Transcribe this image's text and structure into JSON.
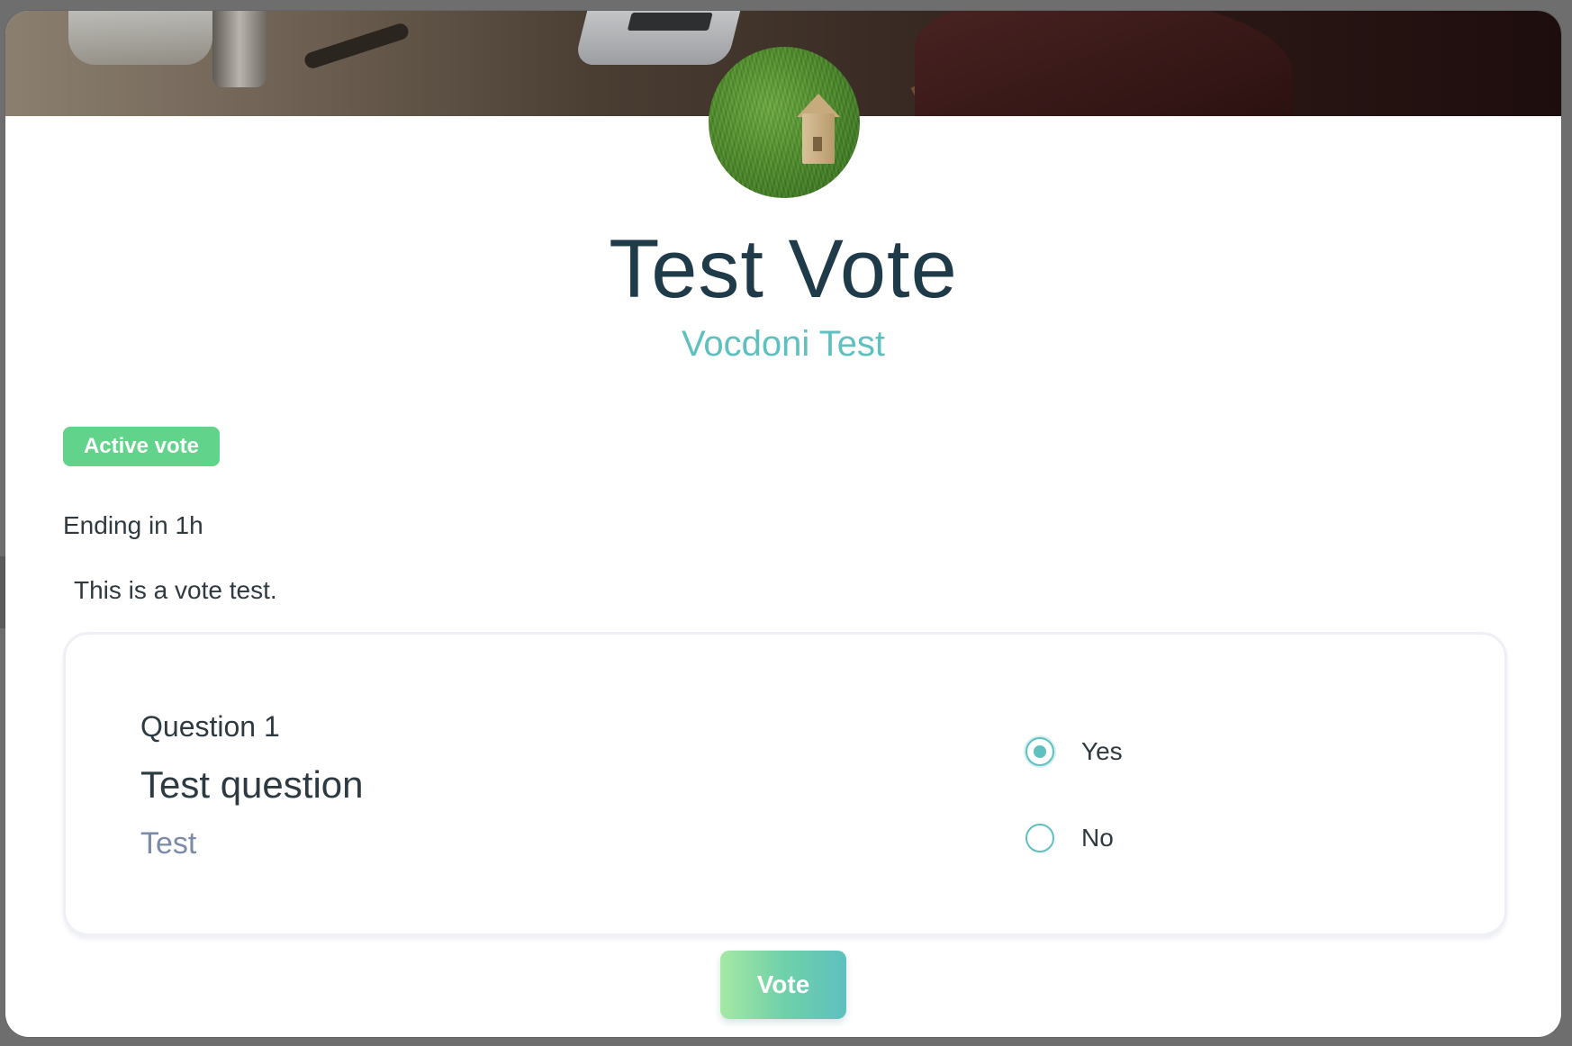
{
  "banner": {
    "image": "workspace-desk-photo"
  },
  "avatar": {
    "image": "grass-wooden-house-photo"
  },
  "process": {
    "title": "Test Vote",
    "organization": "Vocdoni Test",
    "status_badge": "Active vote",
    "ending_text": "Ending in 1h",
    "description": "This is a vote test."
  },
  "question": {
    "number_label": "Question 1",
    "title": "Test question",
    "description": "Test",
    "options": [
      {
        "label": "Yes",
        "selected": true
      },
      {
        "label": "No",
        "selected": false
      }
    ]
  },
  "actions": {
    "vote_label": "Vote"
  },
  "colors": {
    "accent": "#5ec0bf",
    "title": "#1f3b4a",
    "badge": "#62d38a",
    "muted": "#7a8aa8"
  }
}
